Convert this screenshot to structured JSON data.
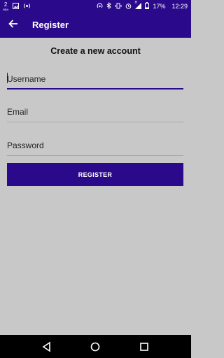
{
  "status_bar": {
    "left_icons": [
      "notification-badge-icon",
      "image-icon",
      "wireless-icon"
    ],
    "badge_number": "2",
    "badge_label": "NBA",
    "right_icons": [
      "hotspot-icon",
      "bluetooth-icon",
      "vibrate-icon",
      "alarm-icon",
      "signal-icon",
      "battery-icon"
    ],
    "network_type": "H",
    "battery": "17%",
    "time": "12:29"
  },
  "app_bar": {
    "back_icon": "arrow-left-icon",
    "title": "Register"
  },
  "form": {
    "heading": "Create a new account",
    "username_placeholder": "Username",
    "email_placeholder": "Email",
    "password_placeholder": "Password",
    "register_label": "REGISTER"
  },
  "nav_bar": {
    "buttons": [
      "back-triangle-icon",
      "home-circle-icon",
      "recents-square-icon"
    ]
  },
  "colors": {
    "primary": "#2a0a8a",
    "background": "#c8c8c8",
    "underline": "#a8a8a8"
  }
}
